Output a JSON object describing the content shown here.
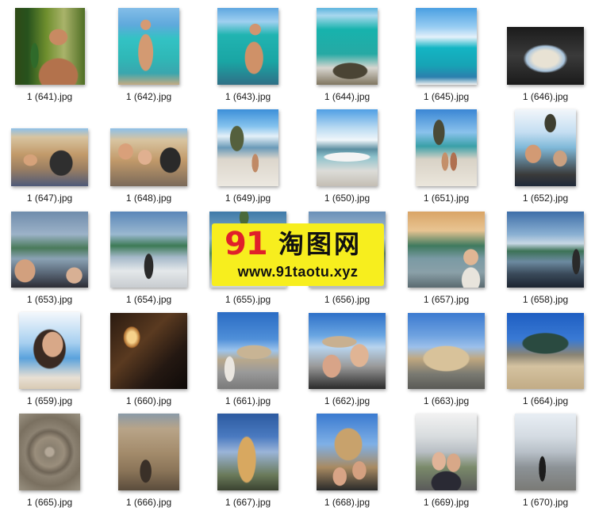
{
  "files": [
    {
      "name": "1 (641).jpg"
    },
    {
      "name": "1 (642).jpg"
    },
    {
      "name": "1 (643).jpg"
    },
    {
      "name": "1 (644).jpg"
    },
    {
      "name": "1 (645).jpg"
    },
    {
      "name": "1 (646).jpg"
    },
    {
      "name": "1 (647).jpg"
    },
    {
      "name": "1 (648).jpg"
    },
    {
      "name": "1 (649).jpg"
    },
    {
      "name": "1 (650).jpg"
    },
    {
      "name": "1 (651).jpg"
    },
    {
      "name": "1 (652).jpg"
    },
    {
      "name": "1 (653).jpg"
    },
    {
      "name": "1 (654).jpg"
    },
    {
      "name": "1 (655).jpg"
    },
    {
      "name": "1 (656).jpg"
    },
    {
      "name": "1 (657).jpg"
    },
    {
      "name": "1 (658).jpg"
    },
    {
      "name": "1 (659).jpg"
    },
    {
      "name": "1 (660).jpg"
    },
    {
      "name": "1 (661).jpg"
    },
    {
      "name": "1 (662).jpg"
    },
    {
      "name": "1 (663).jpg"
    },
    {
      "name": "1 (664).jpg"
    },
    {
      "name": "1 (665).jpg"
    },
    {
      "name": "1 (666).jpg"
    },
    {
      "name": "1 (667).jpg"
    },
    {
      "name": "1 (668).jpg"
    },
    {
      "name": "1 (669).jpg"
    },
    {
      "name": "1 (670).jpg"
    }
  ],
  "watermark": {
    "number": "91",
    "name": "淘图网",
    "url": "www.91taotu.xyz"
  },
  "colors": {
    "background": "#ffffff",
    "label_text": "#1a1a1a",
    "watermark_background": "#f7ee1e",
    "watermark_number": "#e0202a"
  }
}
